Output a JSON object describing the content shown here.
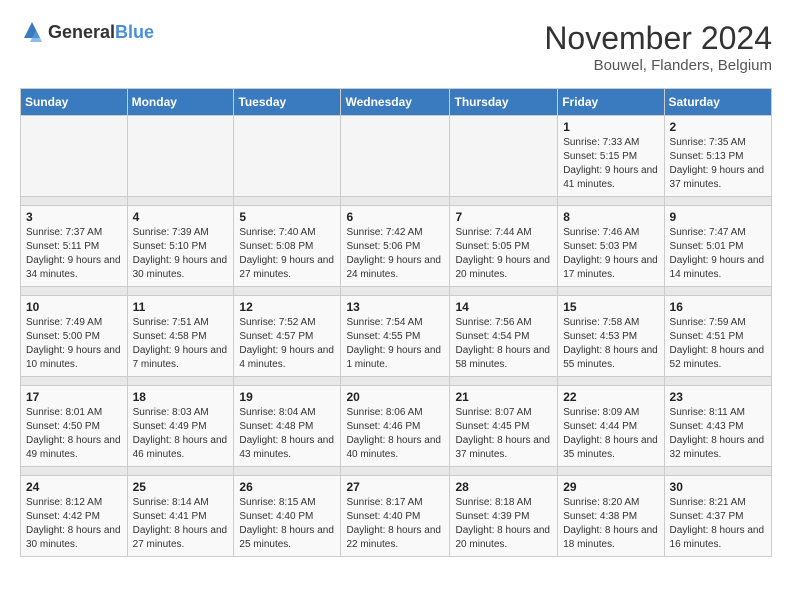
{
  "logo": {
    "text_general": "General",
    "text_blue": "Blue"
  },
  "header": {
    "title": "November 2024",
    "subtitle": "Bouwel, Flanders, Belgium"
  },
  "weekdays": [
    "Sunday",
    "Monday",
    "Tuesday",
    "Wednesday",
    "Thursday",
    "Friday",
    "Saturday"
  ],
  "weeks": [
    [
      {
        "day": "",
        "info": ""
      },
      {
        "day": "",
        "info": ""
      },
      {
        "day": "",
        "info": ""
      },
      {
        "day": "",
        "info": ""
      },
      {
        "day": "",
        "info": ""
      },
      {
        "day": "1",
        "info": "Sunrise: 7:33 AM\nSunset: 5:15 PM\nDaylight: 9 hours\nand 41 minutes."
      },
      {
        "day": "2",
        "info": "Sunrise: 7:35 AM\nSunset: 5:13 PM\nDaylight: 9 hours\nand 37 minutes."
      }
    ],
    [
      {
        "day": "3",
        "info": "Sunrise: 7:37 AM\nSunset: 5:11 PM\nDaylight: 9 hours\nand 34 minutes."
      },
      {
        "day": "4",
        "info": "Sunrise: 7:39 AM\nSunset: 5:10 PM\nDaylight: 9 hours\nand 30 minutes."
      },
      {
        "day": "5",
        "info": "Sunrise: 7:40 AM\nSunset: 5:08 PM\nDaylight: 9 hours\nand 27 minutes."
      },
      {
        "day": "6",
        "info": "Sunrise: 7:42 AM\nSunset: 5:06 PM\nDaylight: 9 hours\nand 24 minutes."
      },
      {
        "day": "7",
        "info": "Sunrise: 7:44 AM\nSunset: 5:05 PM\nDaylight: 9 hours\nand 20 minutes."
      },
      {
        "day": "8",
        "info": "Sunrise: 7:46 AM\nSunset: 5:03 PM\nDaylight: 9 hours\nand 17 minutes."
      },
      {
        "day": "9",
        "info": "Sunrise: 7:47 AM\nSunset: 5:01 PM\nDaylight: 9 hours\nand 14 minutes."
      }
    ],
    [
      {
        "day": "10",
        "info": "Sunrise: 7:49 AM\nSunset: 5:00 PM\nDaylight: 9 hours\nand 10 minutes."
      },
      {
        "day": "11",
        "info": "Sunrise: 7:51 AM\nSunset: 4:58 PM\nDaylight: 9 hours\nand 7 minutes."
      },
      {
        "day": "12",
        "info": "Sunrise: 7:52 AM\nSunset: 4:57 PM\nDaylight: 9 hours\nand 4 minutes."
      },
      {
        "day": "13",
        "info": "Sunrise: 7:54 AM\nSunset: 4:55 PM\nDaylight: 9 hours\nand 1 minute."
      },
      {
        "day": "14",
        "info": "Sunrise: 7:56 AM\nSunset: 4:54 PM\nDaylight: 8 hours\nand 58 minutes."
      },
      {
        "day": "15",
        "info": "Sunrise: 7:58 AM\nSunset: 4:53 PM\nDaylight: 8 hours\nand 55 minutes."
      },
      {
        "day": "16",
        "info": "Sunrise: 7:59 AM\nSunset: 4:51 PM\nDaylight: 8 hours\nand 52 minutes."
      }
    ],
    [
      {
        "day": "17",
        "info": "Sunrise: 8:01 AM\nSunset: 4:50 PM\nDaylight: 8 hours\nand 49 minutes."
      },
      {
        "day": "18",
        "info": "Sunrise: 8:03 AM\nSunset: 4:49 PM\nDaylight: 8 hours\nand 46 minutes."
      },
      {
        "day": "19",
        "info": "Sunrise: 8:04 AM\nSunset: 4:48 PM\nDaylight: 8 hours\nand 43 minutes."
      },
      {
        "day": "20",
        "info": "Sunrise: 8:06 AM\nSunset: 4:46 PM\nDaylight: 8 hours\nand 40 minutes."
      },
      {
        "day": "21",
        "info": "Sunrise: 8:07 AM\nSunset: 4:45 PM\nDaylight: 8 hours\nand 37 minutes."
      },
      {
        "day": "22",
        "info": "Sunrise: 8:09 AM\nSunset: 4:44 PM\nDaylight: 8 hours\nand 35 minutes."
      },
      {
        "day": "23",
        "info": "Sunrise: 8:11 AM\nSunset: 4:43 PM\nDaylight: 8 hours\nand 32 minutes."
      }
    ],
    [
      {
        "day": "24",
        "info": "Sunrise: 8:12 AM\nSunset: 4:42 PM\nDaylight: 8 hours\nand 30 minutes."
      },
      {
        "day": "25",
        "info": "Sunrise: 8:14 AM\nSunset: 4:41 PM\nDaylight: 8 hours\nand 27 minutes."
      },
      {
        "day": "26",
        "info": "Sunrise: 8:15 AM\nSunset: 4:40 PM\nDaylight: 8 hours\nand 25 minutes."
      },
      {
        "day": "27",
        "info": "Sunrise: 8:17 AM\nSunset: 4:40 PM\nDaylight: 8 hours\nand 22 minutes."
      },
      {
        "day": "28",
        "info": "Sunrise: 8:18 AM\nSunset: 4:39 PM\nDaylight: 8 hours\nand 20 minutes."
      },
      {
        "day": "29",
        "info": "Sunrise: 8:20 AM\nSunset: 4:38 PM\nDaylight: 8 hours\nand 18 minutes."
      },
      {
        "day": "30",
        "info": "Sunrise: 8:21 AM\nSunset: 4:37 PM\nDaylight: 8 hours\nand 16 minutes."
      }
    ]
  ]
}
